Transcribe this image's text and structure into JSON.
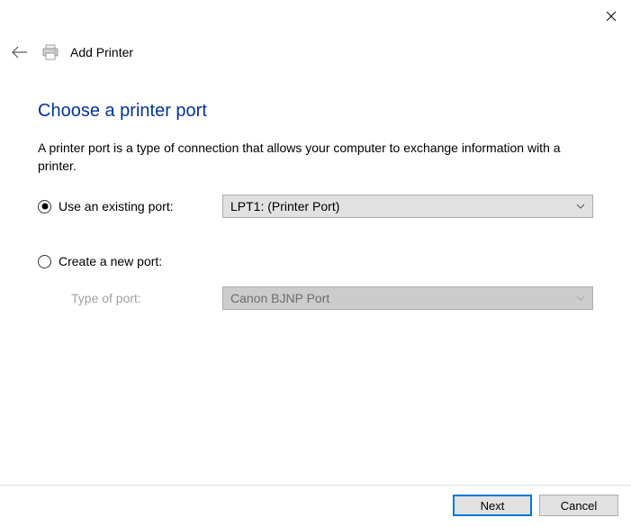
{
  "header": {
    "wizard_title": "Add Printer"
  },
  "main": {
    "title": "Choose a printer port",
    "description": "A printer port is a type of connection that allows your computer to exchange information with a printer.",
    "options": {
      "existing": {
        "label": "Use an existing port:",
        "dropdown_value": "LPT1: (Printer Port)"
      },
      "create": {
        "label": "Create a new port:",
        "type_label": "Type of port:",
        "type_dropdown_value": "Canon BJNP Port"
      }
    }
  },
  "buttons": {
    "next": "Next",
    "cancel": "Cancel"
  }
}
